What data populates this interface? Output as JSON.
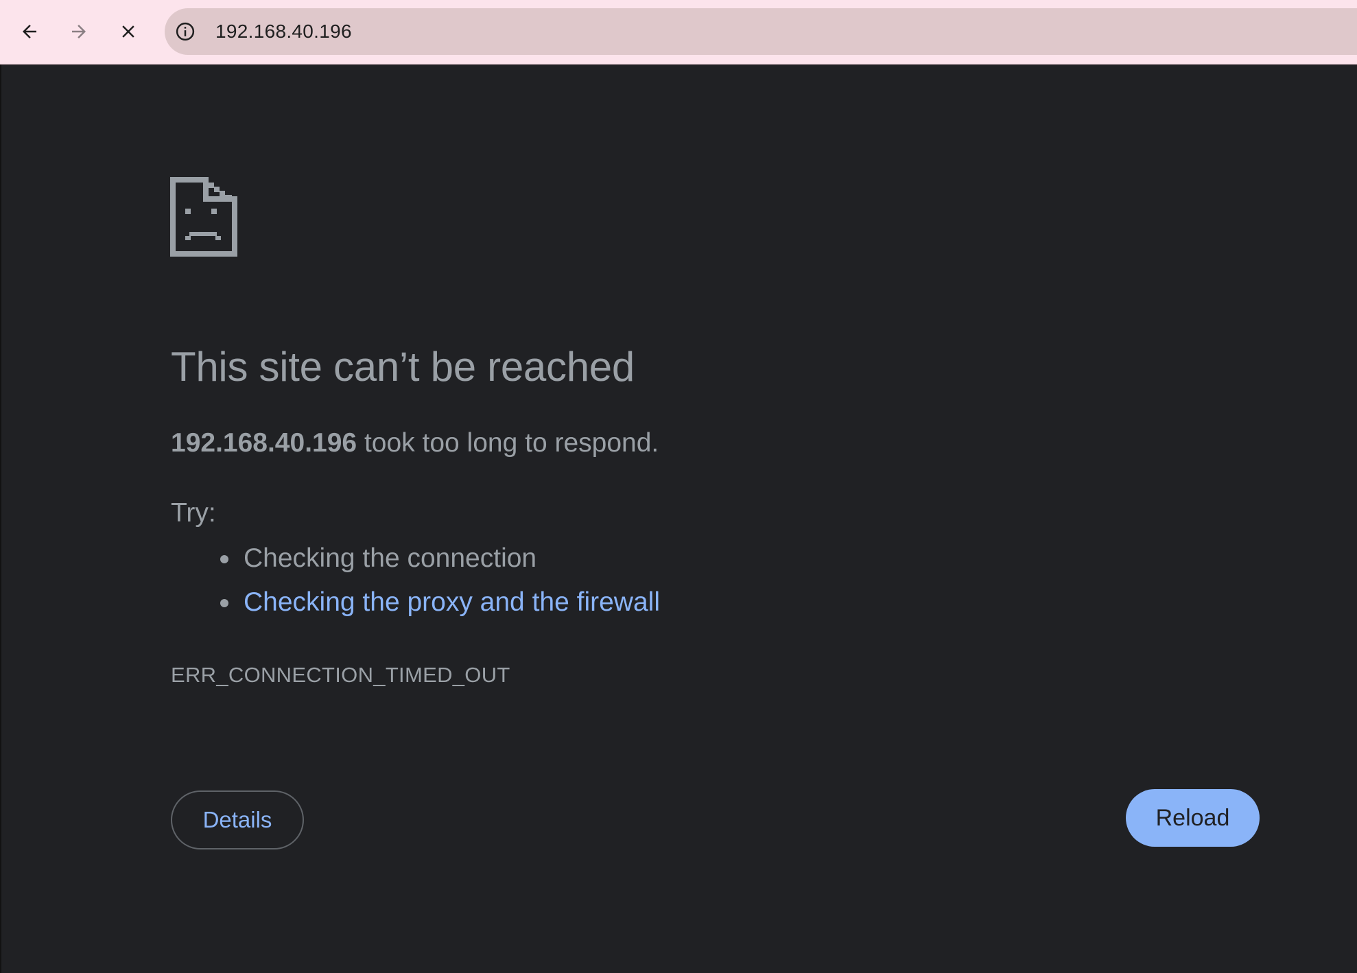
{
  "browser": {
    "url": "192.168.40.196",
    "icons": {
      "back": "arrow-left-icon",
      "forward": "arrow-right-icon",
      "stop": "close-icon",
      "site_info": "info-icon"
    },
    "colors": {
      "toolbar": "#fce4ec",
      "omnibox": "#dfc8cb"
    }
  },
  "error_page": {
    "icon": "sad-document-icon",
    "heading": "This site can’t be reached",
    "host": "192.168.40.196",
    "message": " took too long to respond.",
    "try_label": "Try:",
    "suggestions": [
      {
        "text": "Checking the connection",
        "link": false
      },
      {
        "text": "Checking the proxy and the firewall",
        "link": true
      }
    ],
    "error_code": "ERR_CONNECTION_TIMED_OUT",
    "details_label": "Details",
    "reload_label": "Reload",
    "colors": {
      "background": "#202124",
      "text": "#9aa0a6",
      "link": "#8ab4f8",
      "primary_button": "#8ab4f8"
    }
  }
}
